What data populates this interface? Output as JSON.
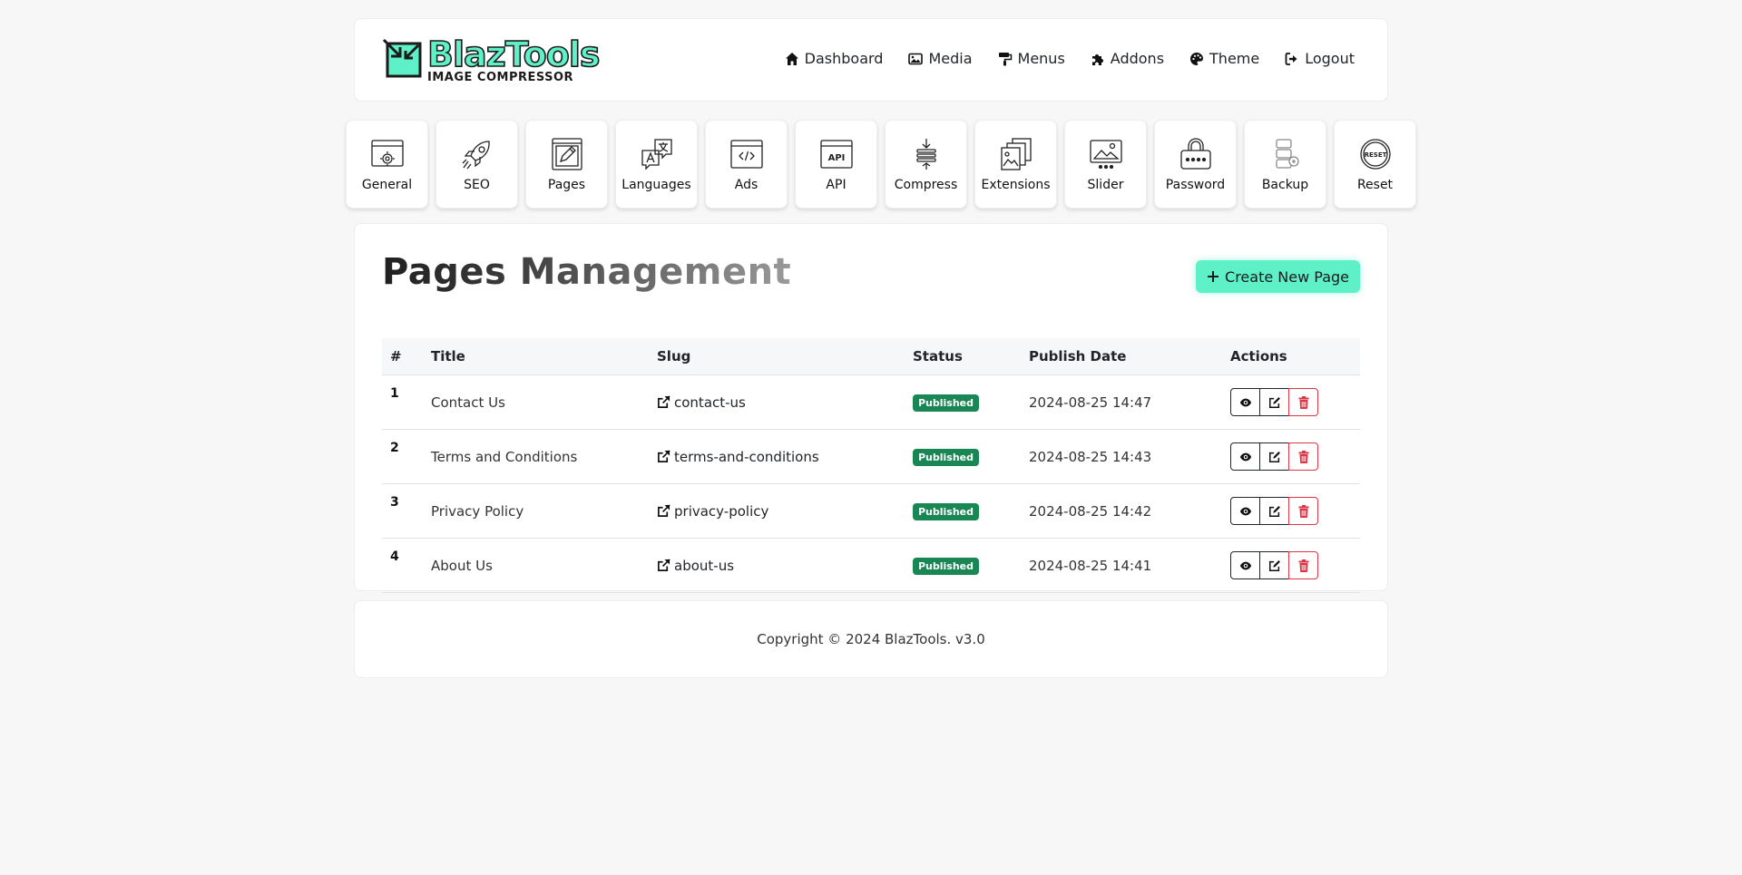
{
  "brand": {
    "name": "BlazTools",
    "tagline": "IMAGE COMPRESSOR"
  },
  "nav": [
    {
      "label": "Dashboard",
      "icon": "home-icon"
    },
    {
      "label": "Media",
      "icon": "image-icon"
    },
    {
      "label": "Menus",
      "icon": "paint-roller-icon"
    },
    {
      "label": "Addons",
      "icon": "puzzle-icon"
    },
    {
      "label": "Theme",
      "icon": "palette-icon"
    },
    {
      "label": "Logout",
      "icon": "logout-icon"
    }
  ],
  "tiles": [
    {
      "label": "General",
      "icon": "browser-gear-icon"
    },
    {
      "label": "SEO",
      "icon": "rocket-icon"
    },
    {
      "label": "Pages",
      "icon": "page-edit-icon"
    },
    {
      "label": "Languages",
      "icon": "translate-icon"
    },
    {
      "label": "Ads",
      "icon": "code-window-icon"
    },
    {
      "label": "API",
      "icon": "api-window-icon"
    },
    {
      "label": "Compress",
      "icon": "compress-icon"
    },
    {
      "label": "Extensions",
      "icon": "file-images-icon"
    },
    {
      "label": "Slider",
      "icon": "slider-image-icon"
    },
    {
      "label": "Password",
      "icon": "lock-password-icon"
    },
    {
      "label": "Backup",
      "icon": "database-backup-icon"
    },
    {
      "label": "Reset",
      "icon": "reset-icon"
    }
  ],
  "main": {
    "title": "Pages Management",
    "create_label": "Create New Page",
    "columns": [
      "#",
      "Title",
      "Slug",
      "Status",
      "Publish Date",
      "Actions"
    ],
    "rows": [
      {
        "num": "1",
        "title": "Contact Us",
        "slug": "contact-us",
        "status": "Published",
        "date": "2024-08-25 14:47"
      },
      {
        "num": "2",
        "title": "Terms and Conditions",
        "slug": "terms-and-conditions",
        "status": "Published",
        "date": "2024-08-25 14:43"
      },
      {
        "num": "3",
        "title": "Privacy Policy",
        "slug": "privacy-policy",
        "status": "Published",
        "date": "2024-08-25 14:42"
      },
      {
        "num": "4",
        "title": "About Us",
        "slug": "about-us",
        "status": "Published",
        "date": "2024-08-25 14:41"
      }
    ]
  },
  "footer": {
    "text": "Copyright © 2024 BlazTools. v3.0"
  },
  "colors": {
    "accent": "#5ef0c7",
    "success": "#198754",
    "danger": "#dc3545",
    "background": "#f7f7f7"
  }
}
